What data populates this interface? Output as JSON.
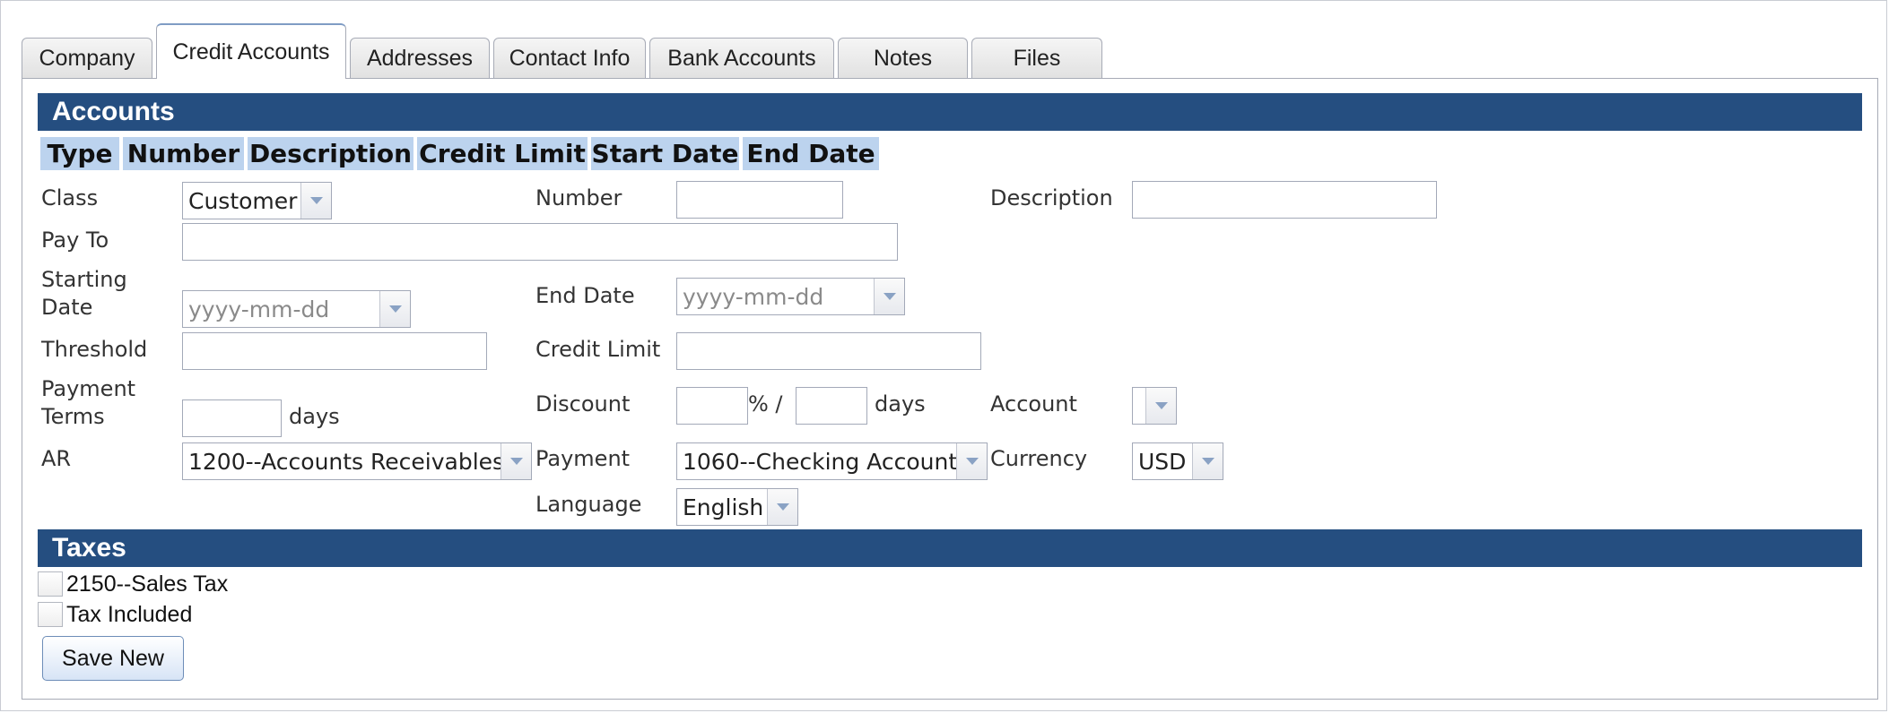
{
  "tabs": [
    {
      "label": "Company",
      "active": false
    },
    {
      "label": "Credit Accounts",
      "active": true
    },
    {
      "label": "Addresses",
      "active": false
    },
    {
      "label": "Contact Info",
      "active": false
    },
    {
      "label": "Bank Accounts",
      "active": false
    },
    {
      "label": "Notes",
      "active": false
    },
    {
      "label": "Files",
      "active": false
    }
  ],
  "accounts": {
    "title": "Accounts",
    "columns": [
      "Type",
      "Number",
      "Description",
      "Credit Limit",
      "Start Date",
      "End Date"
    ]
  },
  "form": {
    "class_label": "Class",
    "class_value": "Customer",
    "number_label": "Number",
    "number_value": "",
    "description_label": "Description",
    "description_value": "",
    "pay_to_label": "Pay To",
    "pay_to_value": "",
    "starting_date_label_1": "Starting",
    "starting_date_label_2": "Date",
    "starting_date_placeholder": "yyyy-mm-dd",
    "end_date_label": "End Date",
    "end_date_placeholder": "yyyy-mm-dd",
    "threshold_label": "Threshold",
    "threshold_value": "",
    "credit_limit_label": "Credit Limit",
    "credit_limit_value": "",
    "payment_terms_label_1": "Payment",
    "payment_terms_label_2": "Terms",
    "payment_terms_value": "",
    "days_label": "days",
    "discount_label": "Discount",
    "discount_percent_value": "",
    "percent_sep": "% /",
    "discount_days_value": "",
    "discount_days_label": "days",
    "account_label": "Account",
    "account_value": "",
    "ar_label": "AR",
    "ar_value": "1200--Accounts Receivables",
    "payment_label": "Payment",
    "payment_value": "1060--Checking Account",
    "currency_label": "Currency",
    "currency_value": "USD",
    "language_label": "Language",
    "language_value": "English"
  },
  "taxes": {
    "title": "Taxes",
    "items": [
      {
        "label": "2150--Sales Tax",
        "checked": false
      },
      {
        "label": "Tax Included",
        "checked": false
      }
    ]
  },
  "actions": {
    "save_new_label": "Save New"
  },
  "colors": {
    "section_bar": "#254e80",
    "column_header": "#bcd3ee"
  }
}
